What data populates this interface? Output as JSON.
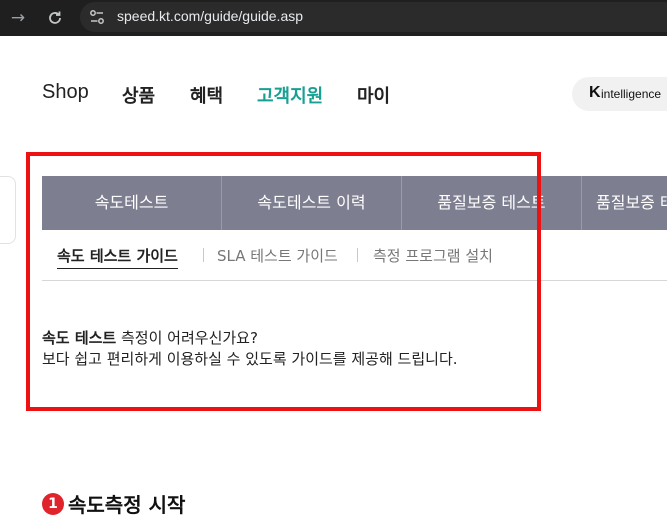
{
  "browser": {
    "url": "speed.kt.com/guide/guide.asp",
    "forward_icon": "forward-arrow-icon",
    "reload_icon": "reload-icon"
  },
  "header": {
    "nav": [
      {
        "label": "Shop",
        "active": false
      },
      {
        "label": "상품",
        "active": false
      },
      {
        "label": "혜택",
        "active": false
      },
      {
        "label": "고객지원",
        "active": true
      },
      {
        "label": "마이",
        "active": false
      }
    ],
    "badge": {
      "mark": "K",
      "text": "intelligence"
    },
    "accent_color": "#18a193"
  },
  "main_tabs": [
    "속도테스트",
    "속도테스트 이력",
    "품질보증 테스트",
    "품질보증 테스트"
  ],
  "main_tab_color": "#7d7f91",
  "sub_tabs": [
    {
      "label": "속도 테스트 가이드",
      "active": true
    },
    {
      "label": "SLA 테스트 가이드",
      "active": false
    },
    {
      "label": "측정 프로그램 설치",
      "active": false
    }
  ],
  "guide": {
    "strong": "속도 테스트",
    "line1_rest": " 측정이 어려우신가요?",
    "line2": "보다 쉽고 편리하게 이용하실 수 있도록 가이드를 제공해 드립니다."
  },
  "section": {
    "number": "1",
    "title": "속도측정 시작"
  },
  "highlight_color": "#ee1111"
}
